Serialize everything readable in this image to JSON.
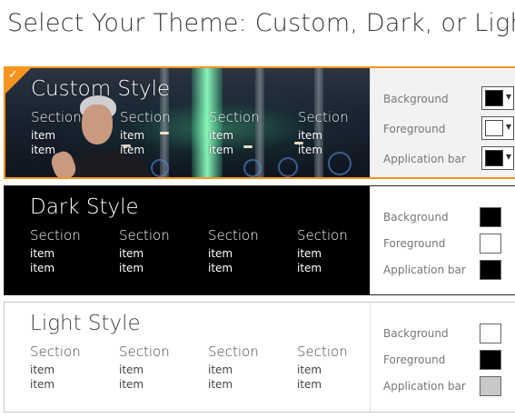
{
  "page": {
    "title": "Select Your Theme: Custom, Dark, or Light"
  },
  "themes": [
    {
      "title": "Custom Style",
      "selected": true,
      "sections": [
        {
          "header": "Section",
          "items": [
            "item",
            "item"
          ]
        },
        {
          "header": "Section",
          "items": [
            "item",
            "item"
          ]
        },
        {
          "header": "Section",
          "items": [
            "item",
            "item"
          ]
        },
        {
          "header": "Section",
          "items": [
            "item",
            "item"
          ]
        }
      ],
      "settings": [
        {
          "label": "Background",
          "color": "#000000"
        },
        {
          "label": "Foreground",
          "color": "#ffffff"
        },
        {
          "label": "Application bar",
          "color": "#000000"
        }
      ]
    },
    {
      "title": "Dark Style",
      "selected": false,
      "sections": [
        {
          "header": "Section",
          "items": [
            "item",
            "item"
          ]
        },
        {
          "header": "Section",
          "items": [
            "item",
            "item"
          ]
        },
        {
          "header": "Section",
          "items": [
            "item",
            "item"
          ]
        },
        {
          "header": "Section",
          "items": [
            "item",
            "item"
          ]
        }
      ],
      "settings": [
        {
          "label": "Background",
          "color": "#000000"
        },
        {
          "label": "Foreground",
          "color": "#ffffff"
        },
        {
          "label": "Application bar",
          "color": "#000000"
        }
      ]
    },
    {
      "title": "Light Style",
      "selected": false,
      "sections": [
        {
          "header": "Section",
          "items": [
            "item",
            "item"
          ]
        },
        {
          "header": "Section",
          "items": [
            "item",
            "item"
          ]
        },
        {
          "header": "Section",
          "items": [
            "item",
            "item"
          ]
        },
        {
          "header": "Section",
          "items": [
            "item",
            "item"
          ]
        }
      ],
      "settings": [
        {
          "label": "Background",
          "color": "#ffffff"
        },
        {
          "label": "Foreground",
          "color": "#000000"
        },
        {
          "label": "Application bar",
          "color": "#c8c8c8"
        }
      ]
    }
  ],
  "colors": {
    "selection_accent": "#f7941d"
  },
  "icons": {
    "selected_marker": "checkmark-icon",
    "dropdown": "chevron-down-icon"
  }
}
